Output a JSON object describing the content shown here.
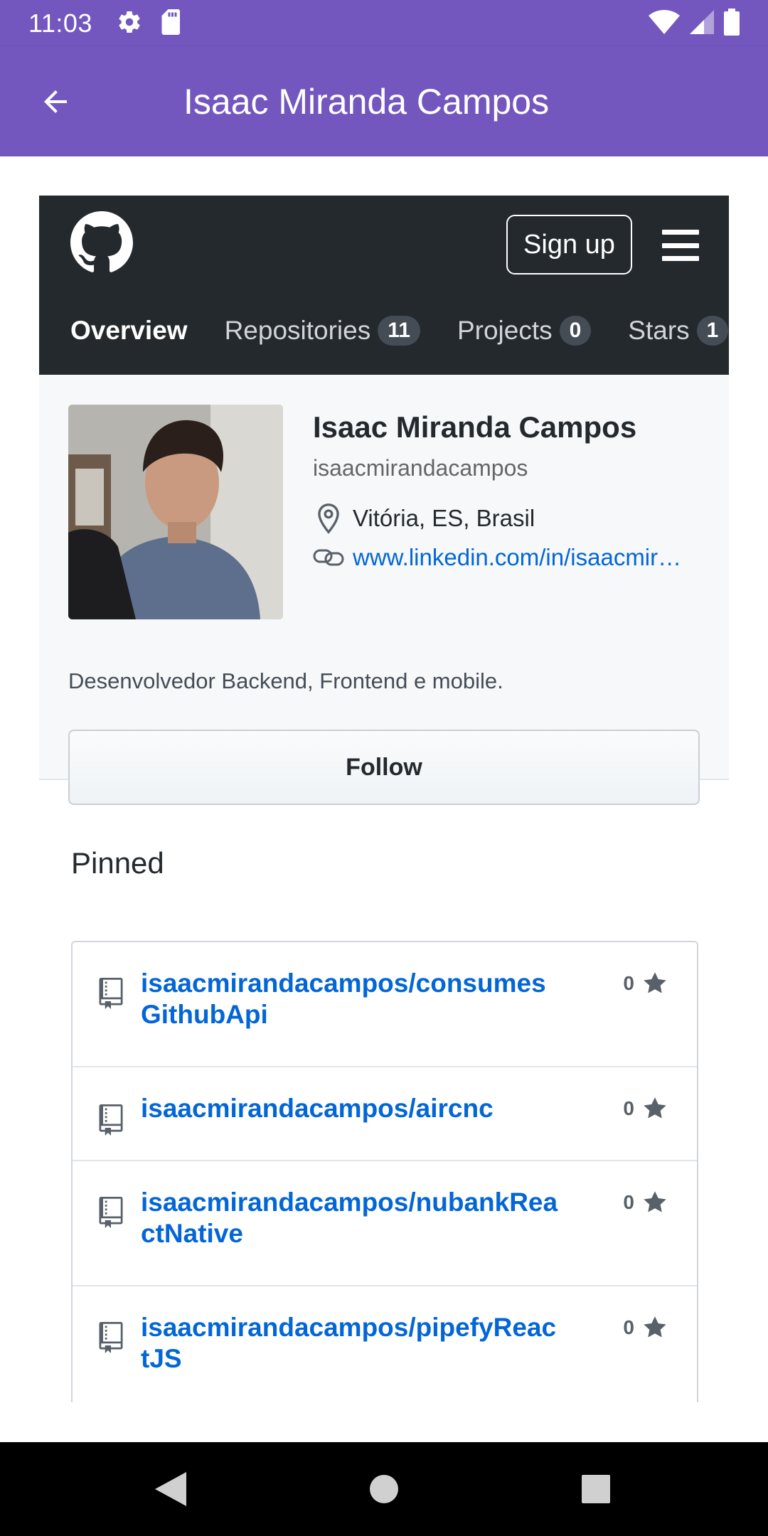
{
  "status_bar": {
    "time": "11:03"
  },
  "app_bar": {
    "title": "Isaac Miranda Campos"
  },
  "github": {
    "signup_label": "Sign up",
    "tabs": [
      {
        "label": "Overview",
        "count": null,
        "active": true
      },
      {
        "label": "Repositories",
        "count": "11",
        "active": false
      },
      {
        "label": "Projects",
        "count": "0",
        "active": false
      },
      {
        "label": "Stars",
        "count": "1",
        "active": false
      }
    ],
    "profile": {
      "name": "Isaac Miranda Campos",
      "login": "isaacmirandacampos",
      "location": "Vitória, ES, Brasil",
      "website": "www.linkedin.com/in/isaacmir…",
      "bio": "Desenvolvedor Backend, Frontend e mobile.",
      "follow_label": "Follow"
    },
    "pinned": {
      "title": "Pinned",
      "items": [
        {
          "name_line1": "isaacmirandacampos/consumes",
          "name_line2": "GithubApi",
          "stars": "0"
        },
        {
          "name_line1": "isaacmirandacampos/aircnc",
          "name_line2": "",
          "stars": "0"
        },
        {
          "name_line1": "isaacmirandacampos/nubankRea",
          "name_line2": "ctNative",
          "stars": "0"
        },
        {
          "name_line1": "isaacmirandacampos/pipefyReac",
          "name_line2": "tJS",
          "stars": "0"
        }
      ]
    }
  },
  "colors": {
    "app_bar": "#7357bf",
    "github_header": "#24292e",
    "link": "#0366d6"
  }
}
